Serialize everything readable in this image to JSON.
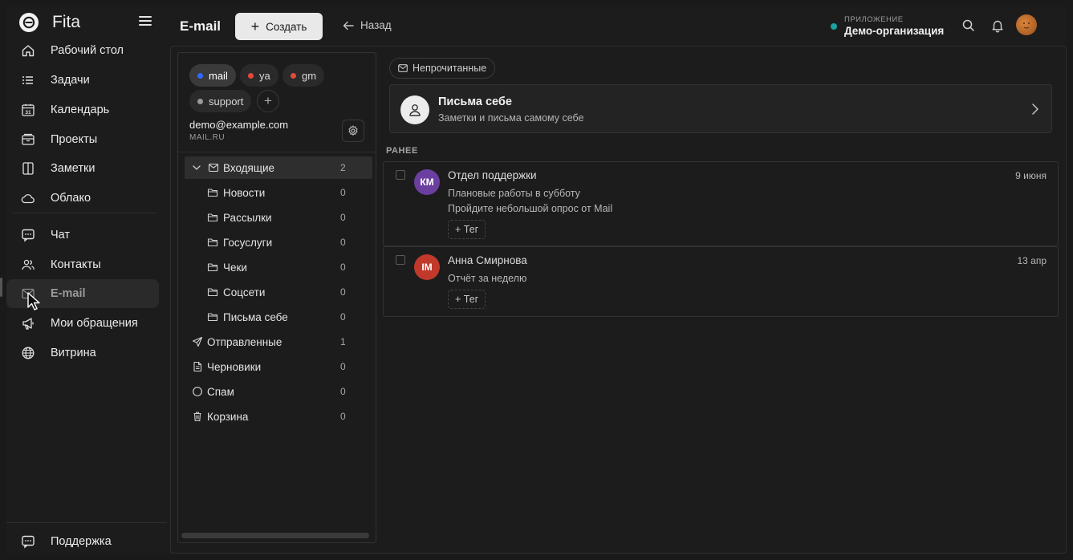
{
  "app": {
    "name": "Fita"
  },
  "sidebar": {
    "items": [
      {
        "label": "Рабочий стол",
        "icon": "home-icon"
      },
      {
        "label": "Задачи",
        "icon": "list-icon"
      },
      {
        "label": "Календарь",
        "icon": "calendar-icon",
        "icon_text": "31"
      },
      {
        "label": "Проекты",
        "icon": "projects-icon"
      },
      {
        "label": "Заметки",
        "icon": "notes-icon"
      },
      {
        "label": "Облако",
        "icon": "cloud-icon"
      },
      {
        "label": "Чат",
        "icon": "chat-icon"
      },
      {
        "label": "Контакты",
        "icon": "contacts-icon"
      },
      {
        "label": "E-mail",
        "icon": "email-icon",
        "active": true
      },
      {
        "label": "Мои обращения",
        "icon": "megaphone-icon"
      },
      {
        "label": "Витрина",
        "icon": "globe-icon"
      }
    ],
    "support_label": "Поддержка"
  },
  "topbar": {
    "title": "E-mail",
    "create_label": "Создать",
    "back_label": "Назад",
    "org_caption": "ПРИЛОЖЕНИЕ",
    "org_name": "Демо-организация",
    "org_status_color": "#1aa3a3"
  },
  "accounts": {
    "chips": [
      {
        "label": "mail",
        "color": "#2f6bff",
        "active": true
      },
      {
        "label": "ya",
        "color": "#e5483c"
      },
      {
        "label": "gm",
        "color": "#e5483c"
      },
      {
        "label": "support",
        "color": "#9a9a9a"
      }
    ],
    "add_label": "+",
    "email": "demo@example.com",
    "provider": "MAIL.RU"
  },
  "folders": [
    {
      "label": "Входящие",
      "count": "2",
      "icon": "mail-icon",
      "expanded": true,
      "active": true
    },
    {
      "label": "Новости",
      "count": "0",
      "icon": "folder-icon",
      "child": true
    },
    {
      "label": "Рассылки",
      "count": "0",
      "icon": "folder-icon",
      "child": true
    },
    {
      "label": "Госуслуги",
      "count": "0",
      "icon": "folder-icon",
      "child": true
    },
    {
      "label": "Чеки",
      "count": "0",
      "icon": "folder-icon",
      "child": true
    },
    {
      "label": "Соцсети",
      "count": "0",
      "icon": "folder-icon",
      "child": true
    },
    {
      "label": "Письма себе",
      "count": "0",
      "icon": "folder-icon",
      "child": true
    },
    {
      "label": "Отправленные",
      "count": "1",
      "icon": "send-icon"
    },
    {
      "label": "Черновики",
      "count": "0",
      "icon": "draft-icon"
    },
    {
      "label": "Спам",
      "count": "0",
      "icon": "spam-icon"
    },
    {
      "label": "Корзина",
      "count": "0",
      "icon": "trash-icon"
    }
  ],
  "mail": {
    "filter_label": "Непрочитанные",
    "self_card": {
      "title": "Письма себе",
      "subtitle": "Заметки и письма самому себе"
    },
    "section_label": "РАНЕЕ",
    "tag_label": "+ Тег",
    "messages": [
      {
        "initials": "КМ",
        "avatar_color": "#6a3fa0",
        "sender": "Отдел поддержки",
        "date": "9 июня",
        "lines": [
          "Плановые работы в субботу",
          "Пройдите небольшой опрос от Mail"
        ]
      },
      {
        "initials": "IM",
        "avatar_color": "#c0392b",
        "sender": "Анна Смирнова",
        "date": "13 апр",
        "lines": [
          "Отчёт за неделю"
        ]
      }
    ]
  }
}
